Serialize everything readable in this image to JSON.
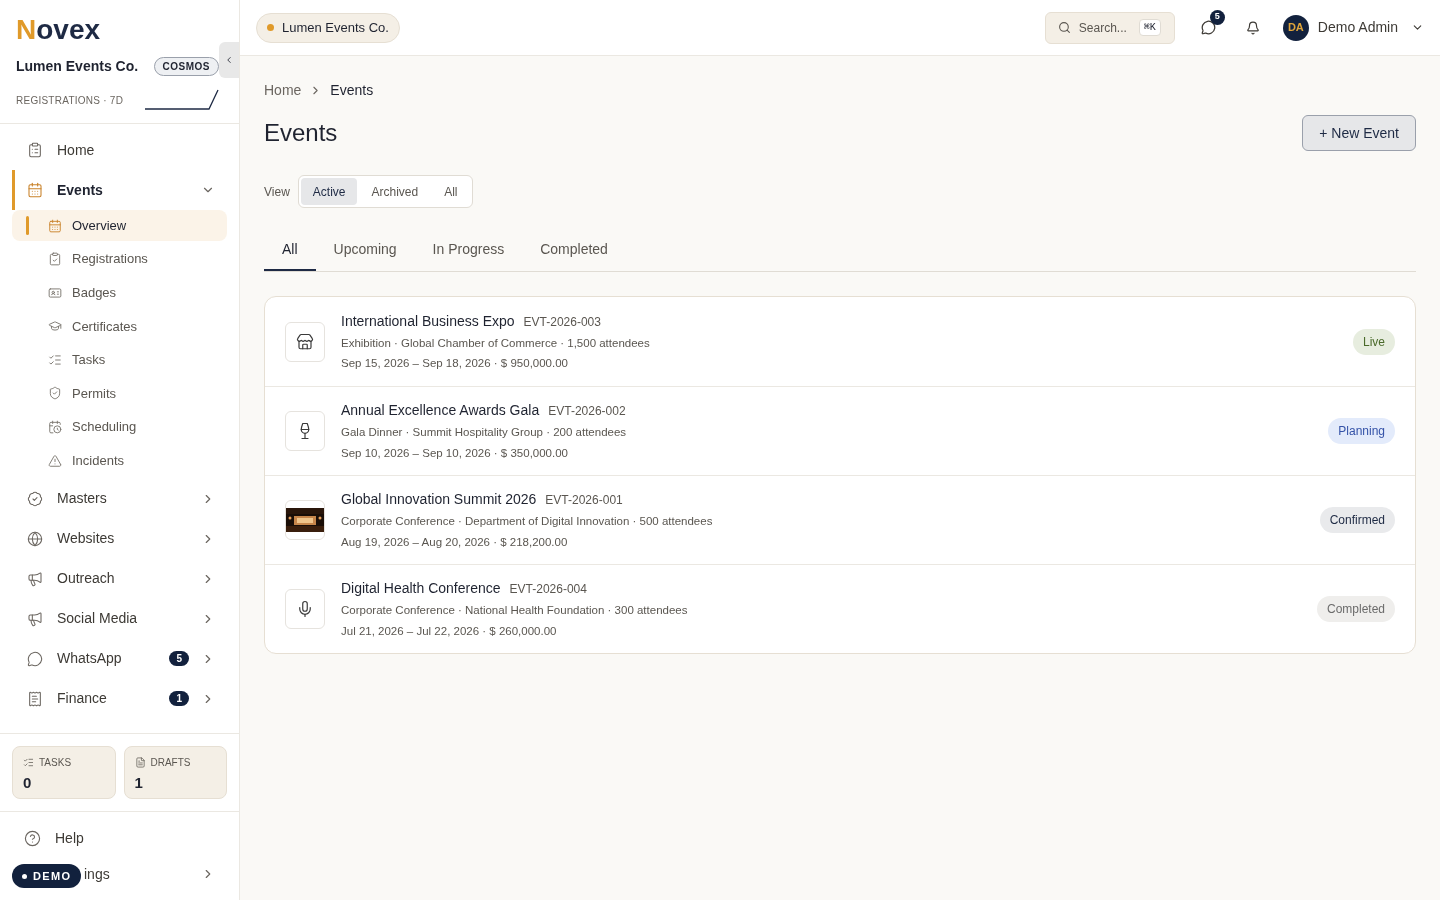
{
  "brand": {
    "logo_initial": "N",
    "logo_rest": "ovex",
    "org": "Lumen Events Co.",
    "plan": "COSMOS",
    "metric_label": "REGISTRATIONS · 7D"
  },
  "nav": [
    {
      "label": "Home",
      "selected": false
    },
    {
      "label": "Events",
      "selected": true,
      "expanded": true,
      "children": [
        {
          "label": "Overview",
          "selected": true
        },
        {
          "label": "Registrations",
          "selected": false
        },
        {
          "label": "Badges",
          "selected": false
        },
        {
          "label": "Certificates",
          "selected": false
        },
        {
          "label": "Tasks",
          "selected": false
        },
        {
          "label": "Permits",
          "selected": false
        },
        {
          "label": "Scheduling",
          "selected": false
        },
        {
          "label": "Incidents",
          "selected": false
        }
      ]
    },
    {
      "label": "Masters",
      "selected": false,
      "expanded": false
    },
    {
      "label": "Websites",
      "selected": false,
      "expanded": false
    },
    {
      "label": "Outreach",
      "selected": false,
      "expanded": false
    },
    {
      "label": "Social Media",
      "selected": false,
      "expanded": false
    },
    {
      "label": "WhatsApp",
      "selected": false,
      "expanded": false,
      "count": "5"
    },
    {
      "label": "Finance",
      "selected": false,
      "expanded": false,
      "count": "1"
    }
  ],
  "stats": [
    {
      "label": "TASKS",
      "value": "0"
    },
    {
      "label": "DRAFTS",
      "value": "1"
    }
  ],
  "footer_nav": [
    {
      "label": "Help"
    },
    {
      "label": "ings",
      "expanded": false
    }
  ],
  "demo_badge": "DEMO",
  "topbar": {
    "workspace": "Lumen Events Co.",
    "search_placeholder": "Search...",
    "shortcut": "⌘K",
    "messages_count": "5",
    "user_initials": "DA",
    "user_name": "Demo Admin"
  },
  "breadcrumb": [
    "Home",
    "Events"
  ],
  "page_title": "Events",
  "new_button": "+ New Event",
  "view": {
    "label": "View",
    "options": [
      {
        "label": "Active",
        "selected": true
      },
      {
        "label": "Archived",
        "selected": false
      },
      {
        "label": "All",
        "selected": false
      }
    ]
  },
  "tabs": [
    {
      "label": "All",
      "selected": true
    },
    {
      "label": "Upcoming",
      "selected": false
    },
    {
      "label": "In Progress",
      "selected": false
    },
    {
      "label": "Completed",
      "selected": false
    }
  ],
  "events": [
    {
      "title": "International Business Expo",
      "code": "EVT-2026-003",
      "meta": "Exhibition · Global Chamber of Commerce · 1,500 attendees",
      "dates": "Sep 15, 2026 – Sep 18, 2026 · $ 950,000.00",
      "kind": "icon",
      "status": "Live",
      "color": "#4a6a2a"
    },
    {
      "title": "Annual Excellence Awards Gala",
      "code": "EVT-2026-002",
      "meta": "Gala Dinner · Summit Hospitality Group · 200 attendees",
      "dates": "Sep 10, 2026 – Sep 10, 2026 · $ 350,000.00",
      "kind": "icon",
      "status": "Planning",
      "color": "#3553a8"
    },
    {
      "title": "Global Innovation Summit 2026",
      "code": "EVT-2026-001",
      "meta": "Corporate Conference · Department of Digital Innovation · 500 attendees",
      "dates": "Aug 19, 2026 – Aug 20, 2026 · $ 218,200.00",
      "kind": "picture",
      "status": "Confirmed",
      "color": "#1e2a44"
    },
    {
      "title": "Digital Health Conference",
      "code": "EVT-2026-004",
      "meta": "Corporate Conference · National Health Foundation · 300 attendees",
      "dates": "Jul 21, 2026 – Jul 22, 2026 · $ 260,000.00",
      "kind": "icon",
      "status": "Completed",
      "color": "#6b6b6b"
    }
  ]
}
